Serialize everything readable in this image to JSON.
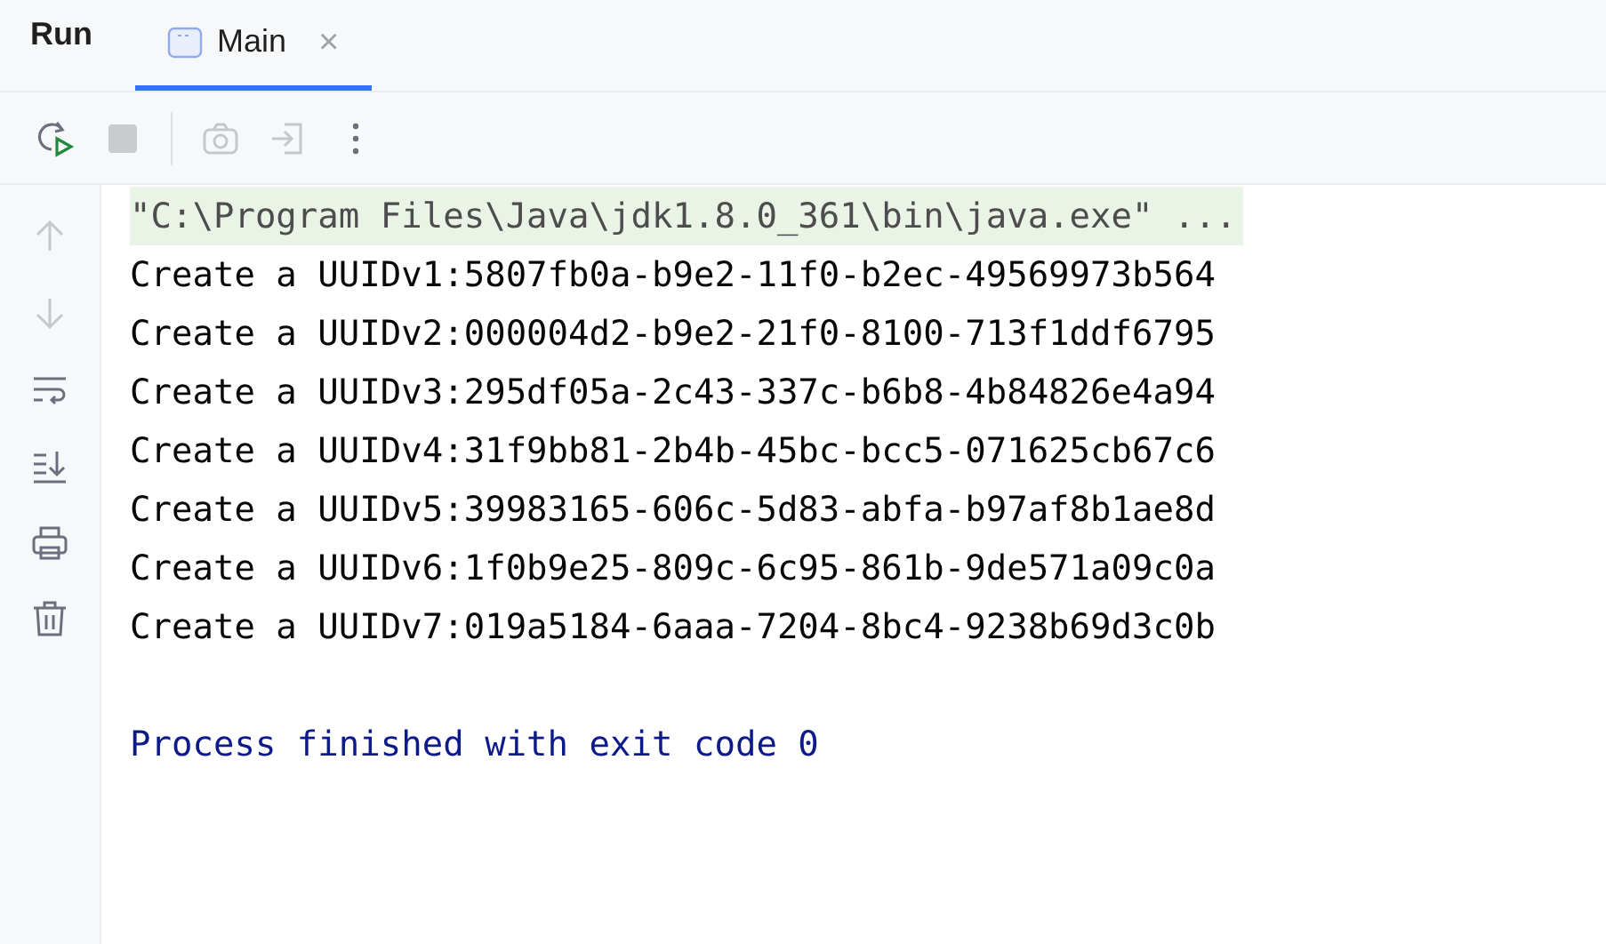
{
  "header": {
    "title": "Run",
    "tabs": [
      {
        "label": "Main",
        "selected": true,
        "close": "×"
      }
    ]
  },
  "toolbar": [
    {
      "kind": "rerun",
      "disabled": false
    },
    {
      "kind": "stop",
      "disabled": true
    },
    {
      "kind": "divider"
    },
    {
      "kind": "camera",
      "disabled": true
    },
    {
      "kind": "login",
      "disabled": true
    },
    {
      "kind": "more",
      "disabled": false
    }
  ],
  "side_tools": [
    {
      "kind": "up",
      "disabled": true
    },
    {
      "kind": "down",
      "disabled": true
    },
    {
      "kind": "wrap",
      "disabled": false
    },
    {
      "kind": "scroll-end",
      "disabled": false
    },
    {
      "kind": "print",
      "disabled": false
    },
    {
      "kind": "trash",
      "disabled": false
    }
  ],
  "console": [
    {
      "kind": "command",
      "text": "\"C:\\Program Files\\Java\\jdk1.8.0_361\\bin\\java.exe\" ..."
    },
    {
      "kind": "output",
      "text": "Create a UUIDv1:5807fb0a-b9e2-11f0-b2ec-49569973b564"
    },
    {
      "kind": "output",
      "text": "Create a UUIDv2:000004d2-b9e2-21f0-8100-713f1ddf6795"
    },
    {
      "kind": "output",
      "text": "Create a UUIDv3:295df05a-2c43-337c-b6b8-4b84826e4a94"
    },
    {
      "kind": "output",
      "text": "Create a UUIDv4:31f9bb81-2b4b-45bc-bcc5-071625cb67c6"
    },
    {
      "kind": "output",
      "text": "Create a UUIDv5:39983165-606c-5d83-abfa-b97af8b1ae8d"
    },
    {
      "kind": "output",
      "text": "Create a UUIDv6:1f0b9e25-809c-6c95-861b-9de571a09c0a"
    },
    {
      "kind": "output",
      "text": "Create a UUIDv7:019a5184-6aaa-7204-8bc4-9238b69d3c0b"
    },
    {
      "kind": "blank"
    },
    {
      "kind": "exit",
      "text": "Process finished with exit code 0"
    }
  ]
}
